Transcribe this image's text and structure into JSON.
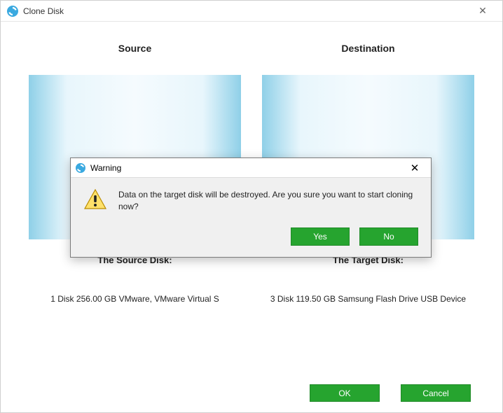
{
  "window": {
    "title": "Clone Disk"
  },
  "source": {
    "heading": "Source",
    "title": "The Source Disk:",
    "desc": "1 Disk 256.00 GB VMware,  VMware Virtual S"
  },
  "destination": {
    "heading": "Destination",
    "title": "The Target Disk:",
    "desc": "3 Disk 119.50 GB Samsung  Flash Drive USB Device"
  },
  "buttons": {
    "ok": "OK",
    "cancel": "Cancel"
  },
  "dialog": {
    "title": "Warning",
    "message": "Data on the target disk will be destroyed. Are you sure you want to start cloning now?",
    "yes": "Yes",
    "no": "No"
  }
}
